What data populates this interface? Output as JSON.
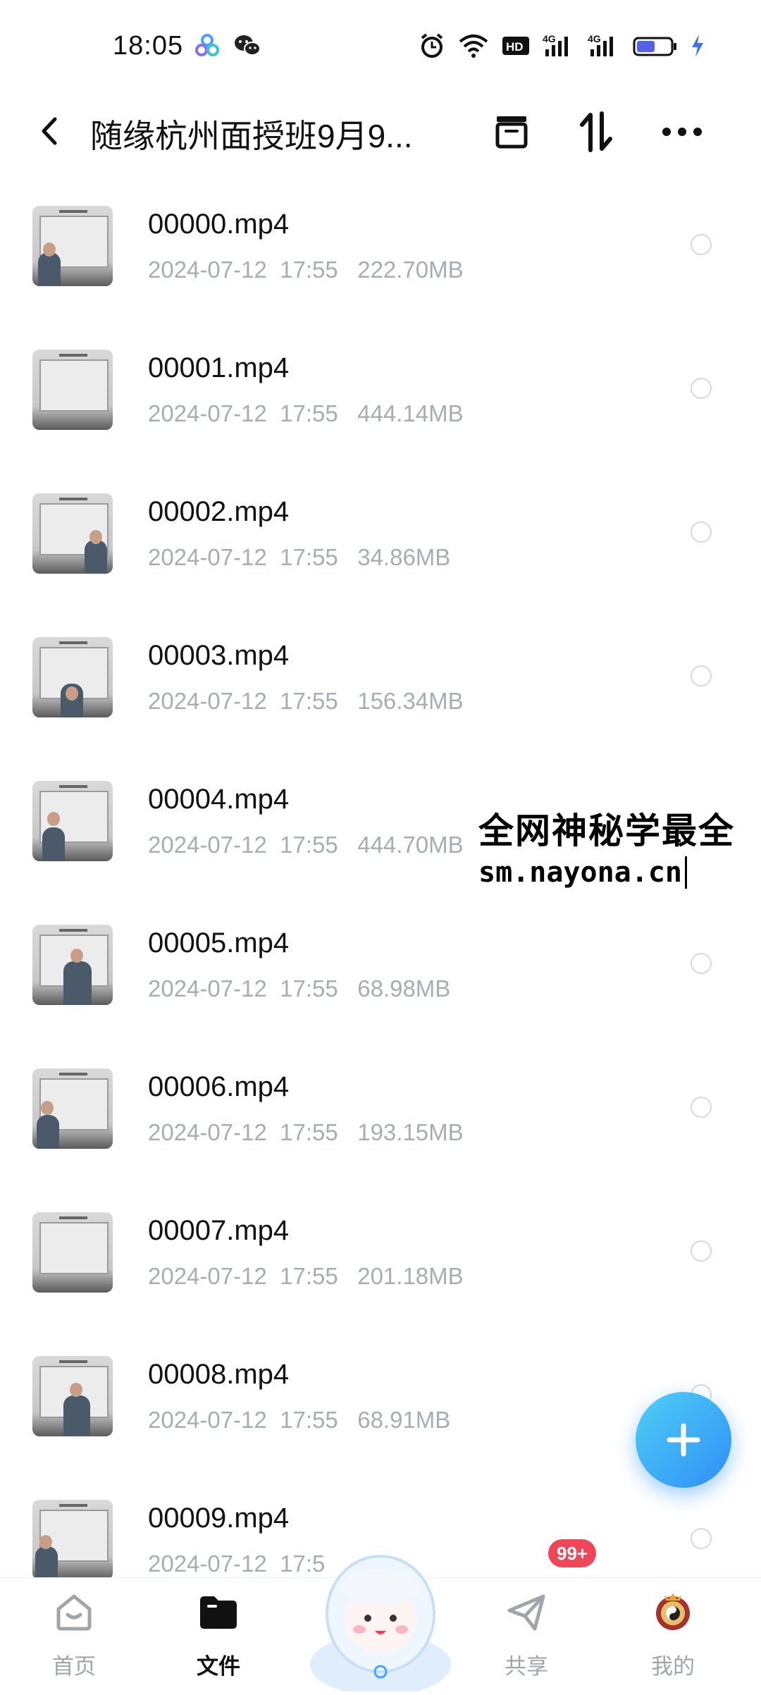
{
  "status_bar": {
    "time": "18:05",
    "left_icons": [
      "nest-app-icon",
      "wechat-icon"
    ],
    "right_icons": [
      "alarm-icon",
      "wifi-icon",
      "hd-icon",
      "4g-signal-icon",
      "4g-signal-icon",
      "battery-icon",
      "charging-icon"
    ],
    "hd_label": "HD",
    "net_label": "4G",
    "battery_level_pct": 55,
    "battery_color": "#5561e6",
    "charging_color": "#3d74f5"
  },
  "header": {
    "title": "随缘杭州面授班9月9...",
    "icons": [
      "back-icon",
      "archive-icon",
      "sort-icon",
      "more-icon"
    ]
  },
  "files": [
    {
      "name": "00000.mp4",
      "meta": "2024-07-12  17:55   222.70MB"
    },
    {
      "name": "00001.mp4",
      "meta": "2024-07-12  17:55   444.14MB"
    },
    {
      "name": "00002.mp4",
      "meta": "2024-07-12  17:55   34.86MB"
    },
    {
      "name": "00003.mp4",
      "meta": "2024-07-12  17:55   156.34MB"
    },
    {
      "name": "00004.mp4",
      "meta": "2024-07-12  17:55   444.70MB"
    },
    {
      "name": "00005.mp4",
      "meta": "2024-07-12  17:55   68.98MB"
    },
    {
      "name": "00006.mp4",
      "meta": "2024-07-12  17:55   193.15MB"
    },
    {
      "name": "00007.mp4",
      "meta": "2024-07-12  17:55   201.18MB"
    },
    {
      "name": "00008.mp4",
      "meta": "2024-07-12  17:55   68.91MB"
    },
    {
      "name": "00009.mp4",
      "meta": "2024-07-12  17:5"
    }
  ],
  "watermark": {
    "line1": "全网神秘学最全",
    "line2": "sm.nayona.cn"
  },
  "fab": {
    "icon": "plus-icon"
  },
  "bottom_nav": {
    "items": [
      {
        "label": "首页",
        "icon": "home-icon",
        "active": false
      },
      {
        "label": "文件",
        "icon": "folder-icon",
        "active": true
      },
      {
        "label": "共享",
        "icon": "share-send-icon",
        "active": false
      },
      {
        "label": "我的",
        "icon": "profile-avatar-icon",
        "active": false
      }
    ],
    "share_badge": "99+",
    "center_icon": "mascot-icon"
  },
  "colors": {
    "accent": "#2f8ef5",
    "badge": "#f0465a",
    "meta_text": "#a8acb3",
    "inactive_nav": "#a0a4ab"
  }
}
